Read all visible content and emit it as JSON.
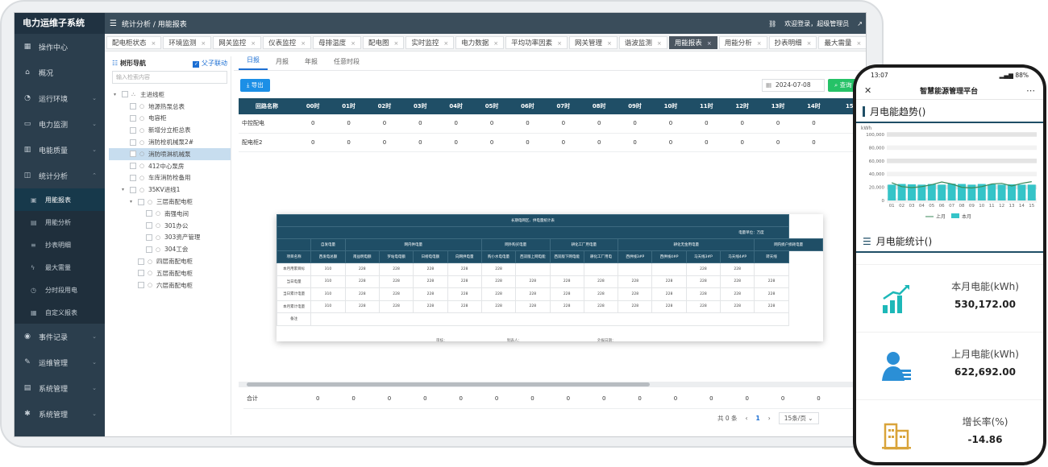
{
  "app": {
    "title": "电力运维子系统"
  },
  "topbar": {
    "breadcrumb": "统计分析 / 用能报表",
    "welcome": "欢迎登录，超级管理员"
  },
  "sidebar": {
    "items": [
      {
        "label": "操作中心",
        "icon": "grid-icon"
      },
      {
        "label": "概况",
        "icon": "home-icon"
      },
      {
        "label": "运行环境",
        "icon": "gauge-icon"
      },
      {
        "label": "电力监测",
        "icon": "monitor-icon"
      },
      {
        "label": "电能质量",
        "icon": "chart-icon"
      },
      {
        "label": "统计分析",
        "icon": "stats-icon"
      }
    ],
    "subitems": [
      "用能报表",
      "用能分析",
      "抄表明细",
      "最大需量",
      "分时段用电",
      "自定义报表"
    ],
    "bottom_items": [
      "事件记录",
      "运维管理",
      "系统管理",
      "系统管理"
    ]
  },
  "tabs": [
    "配电柜状态",
    "环境监测",
    "网关监控",
    "仪表监控",
    "母排温度",
    "配电图",
    "实时监控",
    "电力数据",
    "平均功率因素",
    "网关管理",
    "谐波监测",
    "用能报表",
    "用能分析",
    "抄表明细",
    "最大需量"
  ],
  "active_tab": "用能报表",
  "tree": {
    "title": "树形导航",
    "link_toggle": "父子联动",
    "search_placeholder": "输入检索内容",
    "nodes": [
      {
        "label": "主进线柜",
        "level": 0,
        "arrow": "▾"
      },
      {
        "label": "地源热泵总表",
        "level": 1
      },
      {
        "label": "电容柜",
        "level": 1
      },
      {
        "label": "新增分立柜总表",
        "level": 1
      },
      {
        "label": "消防栓机械泵2#",
        "level": 1
      },
      {
        "label": "消防喷淋机械泵",
        "level": 1,
        "selected": true
      },
      {
        "label": "412中心泵房",
        "level": 1
      },
      {
        "label": "车库消防栓备用",
        "level": 1
      },
      {
        "label": "35KV进线1",
        "level": 1,
        "arrow": "▾"
      },
      {
        "label": "三层南配电柜",
        "level": 2,
        "arrow": "▾"
      },
      {
        "label": "南强电间",
        "level": 3
      },
      {
        "label": "301办公",
        "level": 3
      },
      {
        "label": "303资产管理",
        "level": 3
      },
      {
        "label": "304工会",
        "level": 3
      },
      {
        "label": "四层南配电柜",
        "level": 2
      },
      {
        "label": "五层南配电柜",
        "level": 2
      },
      {
        "label": "六层南配电柜",
        "level": 2
      }
    ]
  },
  "subtabs": [
    "日报",
    "月报",
    "年报",
    "任意时段"
  ],
  "toolbar": {
    "export_label": "导出",
    "date_value": "2024-07-08",
    "query_label": "查询"
  },
  "grid": {
    "header_name": "回路名称",
    "hours": [
      "00时",
      "01时",
      "02时",
      "03时",
      "04时",
      "05时",
      "06时",
      "07时",
      "08时",
      "09时",
      "10时",
      "11时",
      "12时",
      "13时",
      "14时",
      "15"
    ],
    "rows": [
      {
        "name": "中控配电",
        "values": [
          "0",
          "0",
          "0",
          "0",
          "0",
          "0",
          "0",
          "0",
          "0",
          "0",
          "0",
          "0",
          "0",
          "0",
          "0"
        ]
      },
      {
        "name": "配电柜2",
        "values": [
          "0",
          "0",
          "0",
          "0",
          "0",
          "0",
          "0",
          "0",
          "0",
          "0",
          "0",
          "0",
          "0",
          "0",
          "0"
        ]
      }
    ],
    "sum_label": "合计",
    "sum_values": [
      "0",
      "0",
      "0",
      "0",
      "0",
      "0",
      "0",
      "0",
      "0",
      "0",
      "0",
      "0",
      "0",
      "0",
      "0"
    ]
  },
  "report": {
    "title": "长期电网区、供电量统计表",
    "unit": "电量单位：万度",
    "group_headers": [
      "自发电量",
      "网内供电量",
      "网外购买电量",
      "耕化工厂用电量",
      "耕化无金用电量",
      "网内损户损耗电量"
    ],
    "col_headers": [
      "项目名称",
      "西发电总额",
      "南益明电额",
      "罗站电电额",
      "日榜电电额",
      "向网供电量",
      "购小水电电量",
      "西双版上网电能",
      "西双版下网电能",
      "耕化工厂用电",
      "西供线3#P",
      "西供线4#P",
      "马天线3#P",
      "马天线4#P",
      "转天线"
    ],
    "rows": [
      {
        "name": "本月用累目标",
        "values": [
          "310",
          "228",
          "228",
          "228",
          "228",
          "228",
          "",
          "",
          "",
          "",
          "",
          "228",
          "228",
          "",
          ""
        ]
      },
      {
        "name": "当日电量",
        "values": [
          "310",
          "228",
          "228",
          "228",
          "228",
          "228",
          "228",
          "228",
          "228",
          "228",
          "228",
          "228",
          "228",
          "228",
          "228"
        ]
      },
      {
        "name": "当日累计电量",
        "values": [
          "310",
          "228",
          "228",
          "228",
          "228",
          "228",
          "228",
          "228",
          "228",
          "228",
          "228",
          "228",
          "228",
          "228",
          "228"
        ]
      },
      {
        "name": "本月累计电量",
        "values": [
          "310",
          "228",
          "228",
          "228",
          "228",
          "228",
          "228",
          "228",
          "228",
          "228",
          "228",
          "228",
          "228",
          "228",
          "228"
        ]
      }
    ],
    "remark_label": "备注",
    "sign_reviewer": "审核：",
    "sign_maker": "制表人：",
    "sign_date": "外报日期："
  },
  "pager": {
    "total": "共 0 条",
    "current": "1",
    "size": "15条/页"
  },
  "phone": {
    "status_time": "13:07",
    "battery": "88%",
    "title": "智慧能源管理平台",
    "trend_title": "月电能趋势()",
    "stats_title": "月电能统计()",
    "stats": [
      {
        "label": "本月电能(kWh)",
        "value": "530,172.00",
        "icon": "rising-bars-icon"
      },
      {
        "label": "上月电能(kWh)",
        "value": "622,692.00",
        "icon": "user-chart-icon"
      },
      {
        "label": "增长率(%)",
        "value": "-14.86",
        "icon": "buildings-icon"
      }
    ]
  },
  "chart_data": {
    "type": "bar",
    "unit_label": "kWh",
    "categories": [
      "01",
      "02",
      "03",
      "04",
      "05",
      "06",
      "07",
      "08",
      "09",
      "10",
      "11",
      "12",
      "13",
      "14",
      "15"
    ],
    "ylim": [
      0,
      100000
    ],
    "yticks": [
      "100,000",
      "80,000",
      "60,000",
      "40,000",
      "20,000",
      "0"
    ],
    "series": [
      {
        "name": "本月",
        "kind": "bar",
        "color": "#35c4c8",
        "values": [
          24000,
          25000,
          24500,
          24000,
          25000,
          24000,
          25500,
          25000,
          24000,
          25000,
          24500,
          24000,
          24500,
          24000,
          24000
        ]
      },
      {
        "name": "上月",
        "kind": "line",
        "color": "#3a8a5a",
        "values": [
          27000,
          21000,
          19500,
          21000,
          24000,
          28000,
          25000,
          20000,
          19000,
          21000,
          25000,
          26000,
          22000,
          26000,
          28500
        ]
      }
    ],
    "legend": [
      "上月",
      "本月"
    ],
    "legend_position": "bottom"
  }
}
